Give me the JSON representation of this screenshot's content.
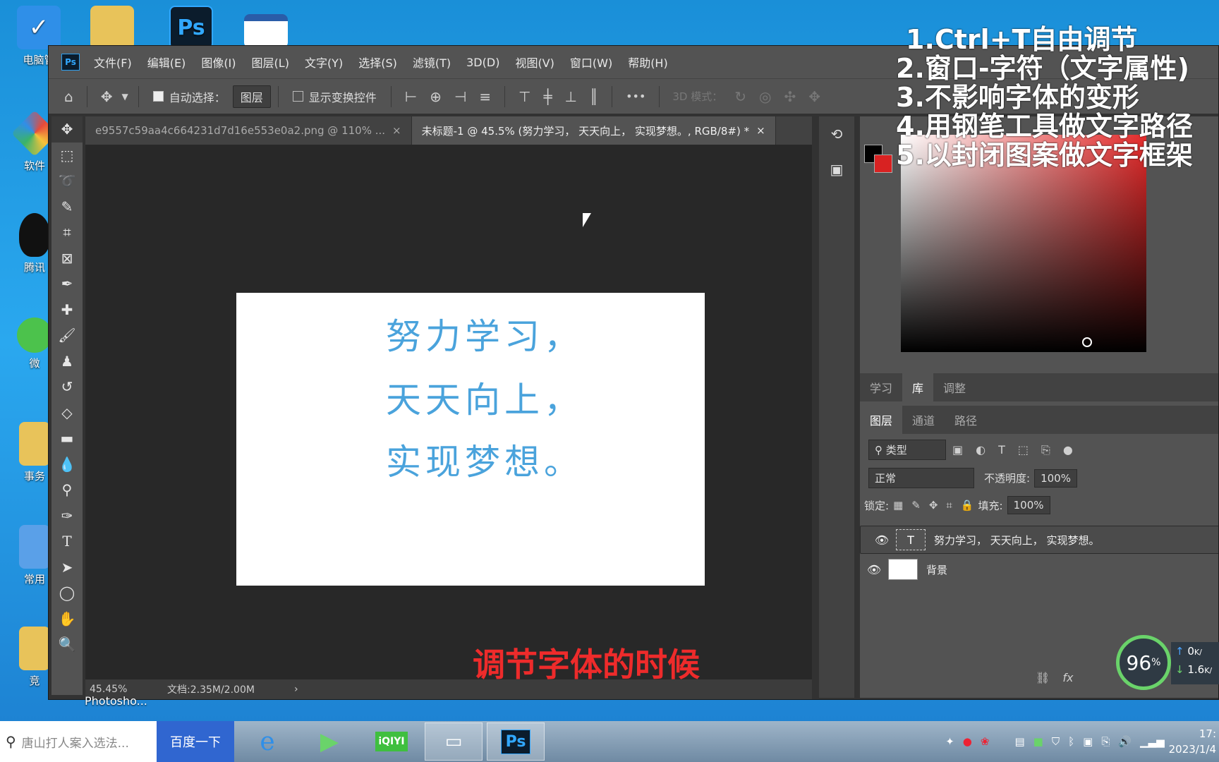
{
  "desktop": {
    "icons": [
      {
        "label": "电脑管",
        "icon": "shield-icon",
        "color": "#2f8fe8"
      },
      {
        "label": "",
        "icon": "folder-icon",
        "color": "#e8c35a"
      },
      {
        "label": "",
        "icon": "photoshop-icon",
        "color": "#0b1c2c"
      },
      {
        "label": "",
        "icon": "psd-file-icon",
        "color": "#ffffff"
      },
      {
        "label": "软件",
        "icon": "software-icon",
        "color": "#e84a3a"
      },
      {
        "label": "腾讯",
        "icon": "qq-icon",
        "color": "#111111"
      },
      {
        "label": "微",
        "icon": "wechat-icon",
        "color": "#4cc24c"
      },
      {
        "label": "事务",
        "icon": "folder-icon",
        "color": "#e8c35a"
      },
      {
        "label": "常用",
        "icon": "folder-icon",
        "color": "#5aa0e8"
      },
      {
        "label": "竞",
        "icon": "folder-icon",
        "color": "#e8c35a"
      }
    ],
    "ps_label": "Photosho..."
  },
  "photoshop": {
    "logo": "Ps",
    "menu": [
      "文件(F)",
      "编辑(E)",
      "图像(I)",
      "图层(L)",
      "文字(Y)",
      "选择(S)",
      "滤镜(T)",
      "3D(D)",
      "视图(V)",
      "窗口(W)",
      "帮助(H)"
    ],
    "options": {
      "auto_select_label": "自动选择：",
      "auto_select_value": "图层",
      "show_transform_label": "显示变换控件",
      "more": "•••",
      "mode_3d": "3D 模式："
    },
    "tabs": [
      {
        "title": "e9557c59aa4c664231d7d16e553e0a2.png @ 110% ...",
        "close": "×"
      },
      {
        "title": "未标题-1 @ 45.5% (努力学习， 天天向上， 实现梦想。, RGB/8#) *",
        "close": "×"
      }
    ],
    "document_lines": [
      "努力学习，",
      "天天向上，",
      "实现梦想。"
    ],
    "status": {
      "zoom": "45.45%",
      "doc": "文档:2.35M/2.00M",
      "arrow": "›"
    },
    "panel_tabs_top": [
      "学习",
      "库",
      "调整"
    ],
    "panel_tabs_layers": [
      "图层",
      "通道",
      "路径"
    ],
    "layers_panel": {
      "filter_label": "类型",
      "blend_mode": "正常",
      "opacity_label": "不透明度:",
      "opacity_value": "100%",
      "lock_label": "锁定:",
      "fill_label": "填充:",
      "fill_value": "100%",
      "layers": [
        {
          "name": "努力学习， 天天向上， 实现梦想。",
          "thumb": "T",
          "selected": true
        },
        {
          "name": "背景",
          "thumb": "",
          "selected": false
        }
      ],
      "fx": "fx"
    }
  },
  "overlay": {
    "notes": [
      "1.Ctrl+T自由调节",
      "2.窗口-字符（文字属性)",
      "3.不影响字体的变形",
      "4.用钢笔工具做文字路径",
      "5.以封闭图案做文字框架"
    ],
    "caption": "调节字体的时候"
  },
  "widget": {
    "percent": "96",
    "unit": "%",
    "up": "0",
    "down": "1.6",
    "up_unit": "K/",
    "down_unit": "K/"
  },
  "taskbar": {
    "search_placeholder": "唐山打人案入选法...",
    "search_button": "百度一下",
    "apps": [
      "ie-icon",
      "player-icon",
      "iqiyi-icon",
      "notepad-icon",
      "photoshop-icon"
    ],
    "iqiyi_text": "iQIYI",
    "ps_text": "Ps",
    "clock_time": "17:",
    "clock_date": "2023/1/4"
  }
}
